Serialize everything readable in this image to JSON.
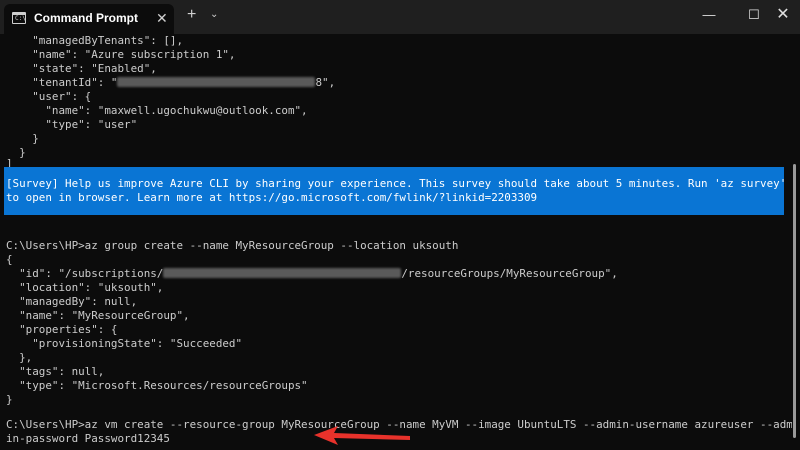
{
  "titlebar": {
    "tab_title": "Command Prompt",
    "tab_icon_text": "C:\\",
    "close_tab_glyph": "✕",
    "new_tab_glyph": "+",
    "dropdown_glyph": "⌄",
    "minimize_glyph": "—",
    "maximize_glyph": "☐",
    "close_window_glyph": "✕"
  },
  "terminal": {
    "block1": [
      "    \"managedByTenants\": [],",
      "    \"name\": \"Azure subscription 1\",",
      "    \"state\": \"Enabled\","
    ],
    "tenant_prefix": "    \"tenantId\": \"",
    "tenant_suffix": "8\",",
    "block2": [
      "    \"user\": {",
      "      \"name\": \"maxwell.ugochukwu@outlook.com\",",
      "      \"type\": \"user\"",
      "    }",
      "  }",
      "]"
    ],
    "survey": [
      "[Survey] Help us improve Azure CLI by sharing your experience. This survey should take about 5 minutes. Run 'az survey'",
      "to open in browser. Learn more at https://go.microsoft.com/fwlink/?linkid=2203309"
    ],
    "command1": "C:\\Users\\HP>az group create --name MyResourceGroup --location uksouth",
    "open_brace": "{",
    "id_prefix": "  \"id\": \"/subscriptions/",
    "id_suffix": "/resourceGroups/MyResourceGroup\",",
    "block3": [
      "  \"location\": \"uksouth\",",
      "  \"managedBy\": null,",
      "  \"name\": \"MyResourceGroup\",",
      "  \"properties\": {",
      "    \"provisioningState\": \"Succeeded\"",
      "  },",
      "  \"tags\": null,",
      "  \"type\": \"Microsoft.Resources/resourceGroups\"",
      "}"
    ],
    "command2_line1": "C:\\Users\\HP>az vm create --resource-group MyResourceGroup --name MyVM --image UbuntuLTS --admin-username azureuser --adm",
    "command2_line2": "in-password Password12345"
  },
  "colors": {
    "terminal_bg": "#0c0c0c",
    "titlebar_bg": "#1f1f1f",
    "survey_bg": "#0a75d4",
    "text": "#cccccc",
    "arrow": "#e8322b"
  }
}
